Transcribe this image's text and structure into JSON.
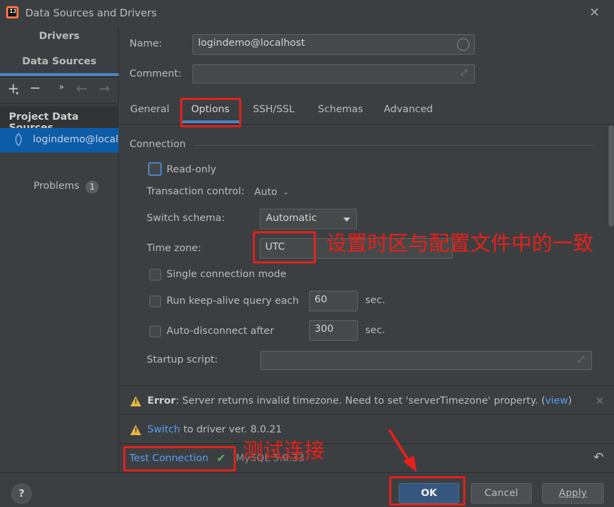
{
  "window": {
    "title": "Data Sources and Drivers"
  },
  "left": {
    "tabs": [
      "Drivers",
      "Data Sources"
    ],
    "section": "Project Data Sources",
    "item": "logindemo@localhost",
    "problems_label": "Problems",
    "problems_count": "1"
  },
  "form": {
    "name_label": "Name:",
    "name_value": "logindemo@localhost",
    "comment_label": "Comment:",
    "comment_value": ""
  },
  "tabs": [
    "General",
    "Options",
    "SSH/SSL",
    "Schemas",
    "Advanced"
  ],
  "options": {
    "group": "Connection",
    "read_only": "Read-only",
    "transaction_label": "Transaction control:",
    "transaction_value": "Auto",
    "switch_schema_label": "Switch schema:",
    "switch_schema_value": "Automatic",
    "timezone_label": "Time zone:",
    "timezone_value": "UTC",
    "single_conn": "Single connection mode",
    "keepalive_label": "Run keep-alive query each",
    "keepalive_value": "60",
    "keepalive_unit": "sec.",
    "autodisc_label": "Auto-disconnect after",
    "autodisc_value": "300",
    "autodisc_unit": "sec.",
    "startup_label": "Startup script:",
    "startup_value": ""
  },
  "notifications": {
    "error_bold": "Error",
    "error_text": ": Server returns invalid timezone. Need to set 'serverTimezone' property. (",
    "error_link": "view",
    "error_end": ")",
    "warn_link": "Switch",
    "warn_text": "to driver ver. 8.0.21"
  },
  "footer": {
    "test_connection": "Test Connection",
    "mysql_text": "MySQL 5.0.33",
    "ok": "OK",
    "cancel": "Cancel",
    "apply": "Apply"
  },
  "annotations": {
    "timezone_note": "设置时区与配置文件中的一致",
    "test_note": "测试连接"
  },
  "colors": {
    "accent": "#4a88c7",
    "annotation": "#e8201a",
    "link": "#589df6",
    "warning": "#e6b63d"
  }
}
